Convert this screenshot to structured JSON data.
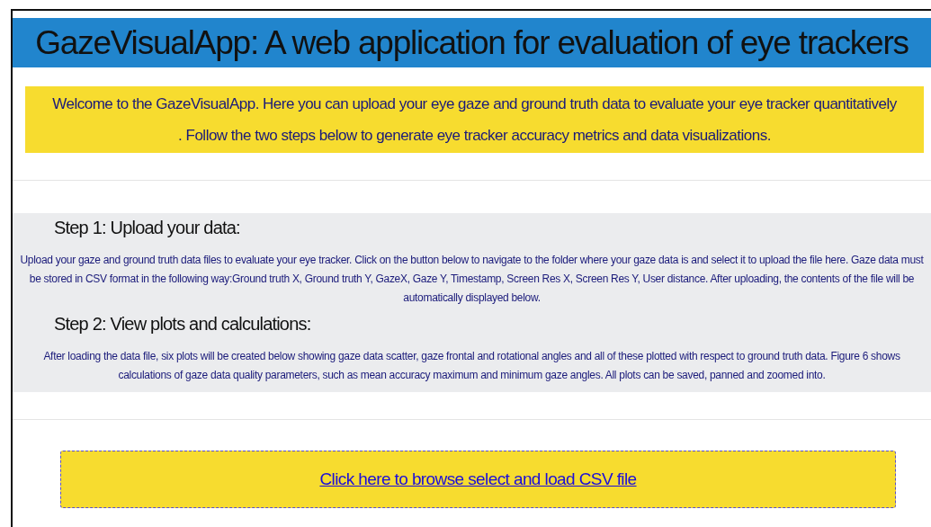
{
  "header": {
    "title": "GazeVisualApp: A web application for evaluation of eye trackers"
  },
  "welcome": {
    "text": "Welcome to the GazeVisualApp. Here you can upload your eye gaze and ground truth data to evaluate your eye tracker quantitatively . Follow the two steps below to generate eye tracker accuracy metrics and data visualizations."
  },
  "steps": [
    {
      "heading": "Step 1: Upload your data:",
      "text": "Upload your gaze and ground truth data files to evaluate your eye tracker. Click on the button below to navigate to the folder where your gaze data is and select it to upload the file here. Gaze data must be stored in CSV format in the following way:Ground truth X, Ground truth Y, GazeX, Gaze Y, Timestamp, Screen Res X, Screen Res Y, User distance. After uploading, the contents of the file will be automatically displayed below."
    },
    {
      "heading": "Step 2: View plots and calculations:",
      "text": "After loading the data file, six plots will be created below showing gaze data scatter, gaze frontal and rotational angles and all of these plotted with respect to ground truth data. Figure 6 shows calculations of gaze data quality parameters, such as mean accuracy maximum and minimum gaze angles. All plots can be saved, panned and zoomed into."
    }
  ],
  "upload": {
    "link": "Click here to browse select and load CSV file"
  }
}
